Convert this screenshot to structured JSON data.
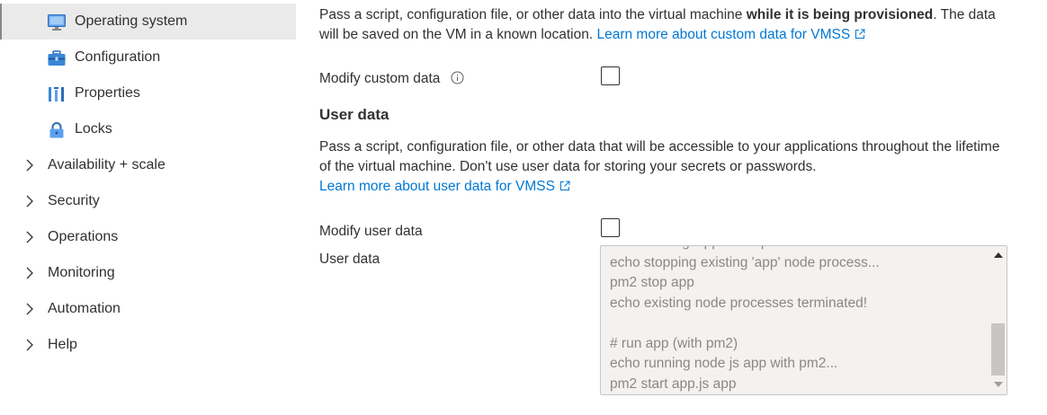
{
  "sidebar": {
    "sub_items": [
      {
        "label": "Operating system",
        "icon": "monitor-icon",
        "selected": true
      },
      {
        "label": "Configuration",
        "icon": "toolbox-icon",
        "selected": false
      },
      {
        "label": "Properties",
        "icon": "properties-bars-icon",
        "selected": false
      },
      {
        "label": "Locks",
        "icon": "lock-icon",
        "selected": false
      }
    ],
    "groups": [
      {
        "label": "Availability + scale"
      },
      {
        "label": "Security"
      },
      {
        "label": "Operations"
      },
      {
        "label": "Monitoring"
      },
      {
        "label": "Automation"
      },
      {
        "label": "Help"
      }
    ]
  },
  "custom_data": {
    "description_part1": "Pass a script, configuration file, or other data into the virtual machine ",
    "description_bold": "while it is being provisioned",
    "description_part2": ". The data will be saved on the VM in a known location.",
    "learn_more": "Learn more about custom data for VMSS",
    "modify_label": "Modify custom data",
    "modify_checked": false
  },
  "user_data": {
    "title": "User data",
    "description": "Pass a script, configuration file, or other data that will be accessible to your applications throughout the lifetime of the virtual machine. Don't use user data for storing your secrets or passwords.",
    "learn_more": "Learn more about user data for VMSS",
    "modify_label": "Modify user data",
    "modify_checked": false,
    "field_label": "User data",
    "textarea_lines": [
      "echo starting 'app' node process...",
      "echo stopping existing 'app' node process...",
      "pm2 stop app",
      "echo existing node processes terminated!",
      "",
      "# run app (with pm2)",
      "echo running node js app with pm2...",
      "pm2 start app.js app"
    ]
  },
  "colors": {
    "link": "#0078d4",
    "text": "#323130",
    "selected_bg": "#eaeaea",
    "textarea_bg": "#f3f2f1",
    "textarea_text": "#8a8886"
  }
}
